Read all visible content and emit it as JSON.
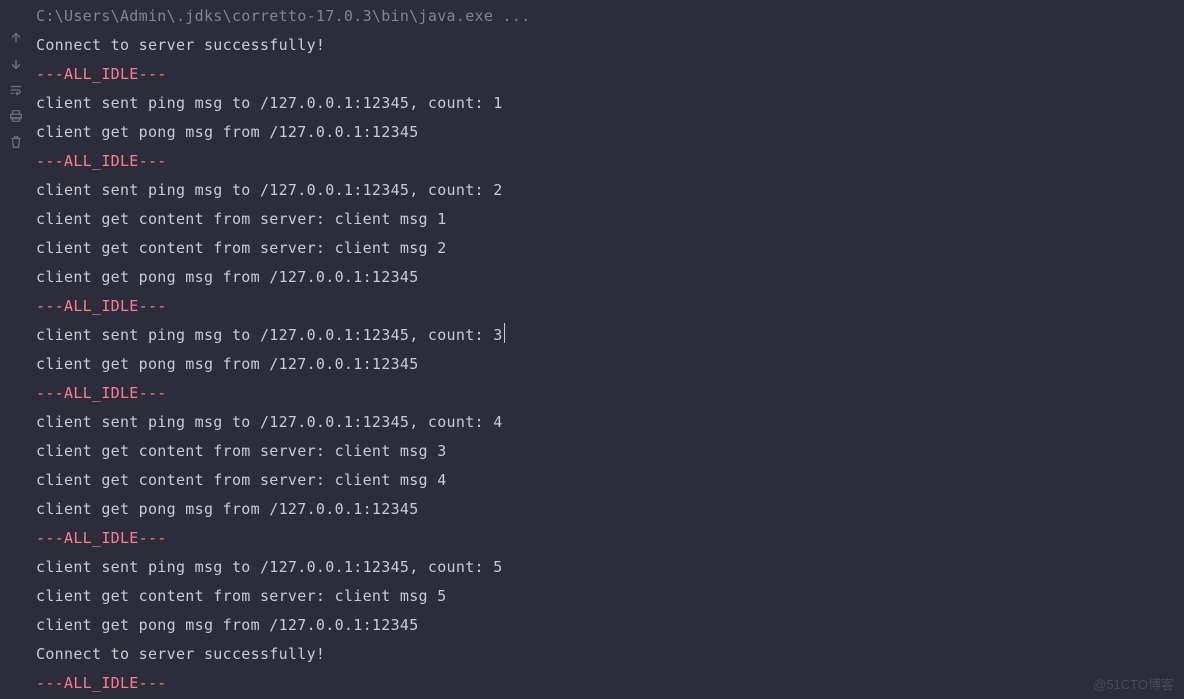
{
  "gutter": {
    "icons": [
      {
        "name": "arrow-up-icon"
      },
      {
        "name": "arrow-down-icon"
      },
      {
        "name": "wrap-lines-icon"
      },
      {
        "name": "print-icon"
      },
      {
        "name": "trash-icon"
      }
    ]
  },
  "console": {
    "lines": [
      {
        "kind": "cmd",
        "text": "C:\\Users\\Admin\\.jdks\\corretto-17.0.3\\bin\\java.exe ..."
      },
      {
        "kind": "text",
        "text": "Connect to server successfully!"
      },
      {
        "kind": "idle",
        "text": "---ALL_IDLE---"
      },
      {
        "kind": "text",
        "text": "client sent ping msg to /127.0.0.1:12345, count: 1"
      },
      {
        "kind": "text",
        "text": "client get pong msg from /127.0.0.1:12345"
      },
      {
        "kind": "idle",
        "text": "---ALL_IDLE---"
      },
      {
        "kind": "text",
        "text": "client sent ping msg to /127.0.0.1:12345, count: 2"
      },
      {
        "kind": "text",
        "text": "client get content from server: client msg 1"
      },
      {
        "kind": "text",
        "text": "client get content from server: client msg 2"
      },
      {
        "kind": "text",
        "text": "client get pong msg from /127.0.0.1:12345"
      },
      {
        "kind": "idle",
        "text": "---ALL_IDLE---"
      },
      {
        "kind": "text",
        "text": "client sent ping msg to /127.0.0.1:12345, count: 3",
        "cursor": true
      },
      {
        "kind": "text",
        "text": "client get pong msg from /127.0.0.1:12345"
      },
      {
        "kind": "idle",
        "text": "---ALL_IDLE---"
      },
      {
        "kind": "text",
        "text": "client sent ping msg to /127.0.0.1:12345, count: 4"
      },
      {
        "kind": "text",
        "text": "client get content from server: client msg 3"
      },
      {
        "kind": "text",
        "text": "client get content from server: client msg 4"
      },
      {
        "kind": "text",
        "text": "client get pong msg from /127.0.0.1:12345"
      },
      {
        "kind": "idle",
        "text": "---ALL_IDLE---"
      },
      {
        "kind": "text",
        "text": "client sent ping msg to /127.0.0.1:12345, count: 5"
      },
      {
        "kind": "text",
        "text": "client get content from server: client msg 5"
      },
      {
        "kind": "text",
        "text": "client get pong msg from /127.0.0.1:12345"
      },
      {
        "kind": "text",
        "text": "Connect to server successfully!"
      },
      {
        "kind": "idle",
        "text": "---ALL_IDLE---"
      }
    ]
  },
  "watermark": "@51CTO博客"
}
